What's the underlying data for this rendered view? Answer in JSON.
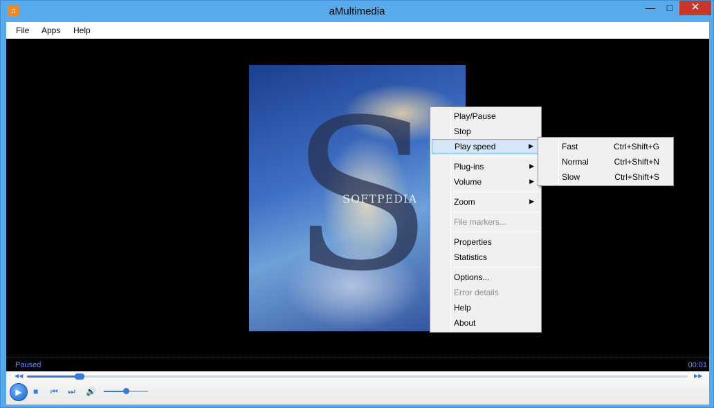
{
  "window": {
    "title": "aMultimedia",
    "icon": "music-note-icon"
  },
  "menubar": {
    "items": [
      "File",
      "Apps",
      "Help"
    ]
  },
  "artwork": {
    "watermark": "SOFTPEDIA"
  },
  "status": {
    "state": "Paused",
    "time": "00:01"
  },
  "playback": {
    "seek_fraction": 0.08,
    "volume_fraction": 0.5
  },
  "context_menu": {
    "items": [
      {
        "label": "Play/Pause"
      },
      {
        "label": "Stop"
      },
      {
        "label": "Play speed",
        "submenu": true,
        "highlighted": true
      },
      {
        "label": "Plug-ins",
        "submenu": true
      },
      {
        "label": "Volume",
        "submenu": true
      },
      {
        "label": "Zoom",
        "submenu": true
      },
      {
        "label": "File markers...",
        "disabled": true
      },
      {
        "label": "Properties"
      },
      {
        "label": "Statistics"
      },
      {
        "label": "Options..."
      },
      {
        "label": "Error details",
        "disabled": true
      },
      {
        "label": "Help"
      },
      {
        "label": "About"
      }
    ]
  },
  "speed_submenu": {
    "items": [
      {
        "label": "Fast",
        "shortcut": "Ctrl+Shift+G"
      },
      {
        "label": "Normal",
        "shortcut": "Ctrl+Shift+N"
      },
      {
        "label": "Slow",
        "shortcut": "Ctrl+Shift+S"
      }
    ]
  },
  "colors": {
    "titlebar": "#58aaeb",
    "close": "#c7382b",
    "accent": "#3c78d8",
    "status_text": "#6b8cff"
  }
}
